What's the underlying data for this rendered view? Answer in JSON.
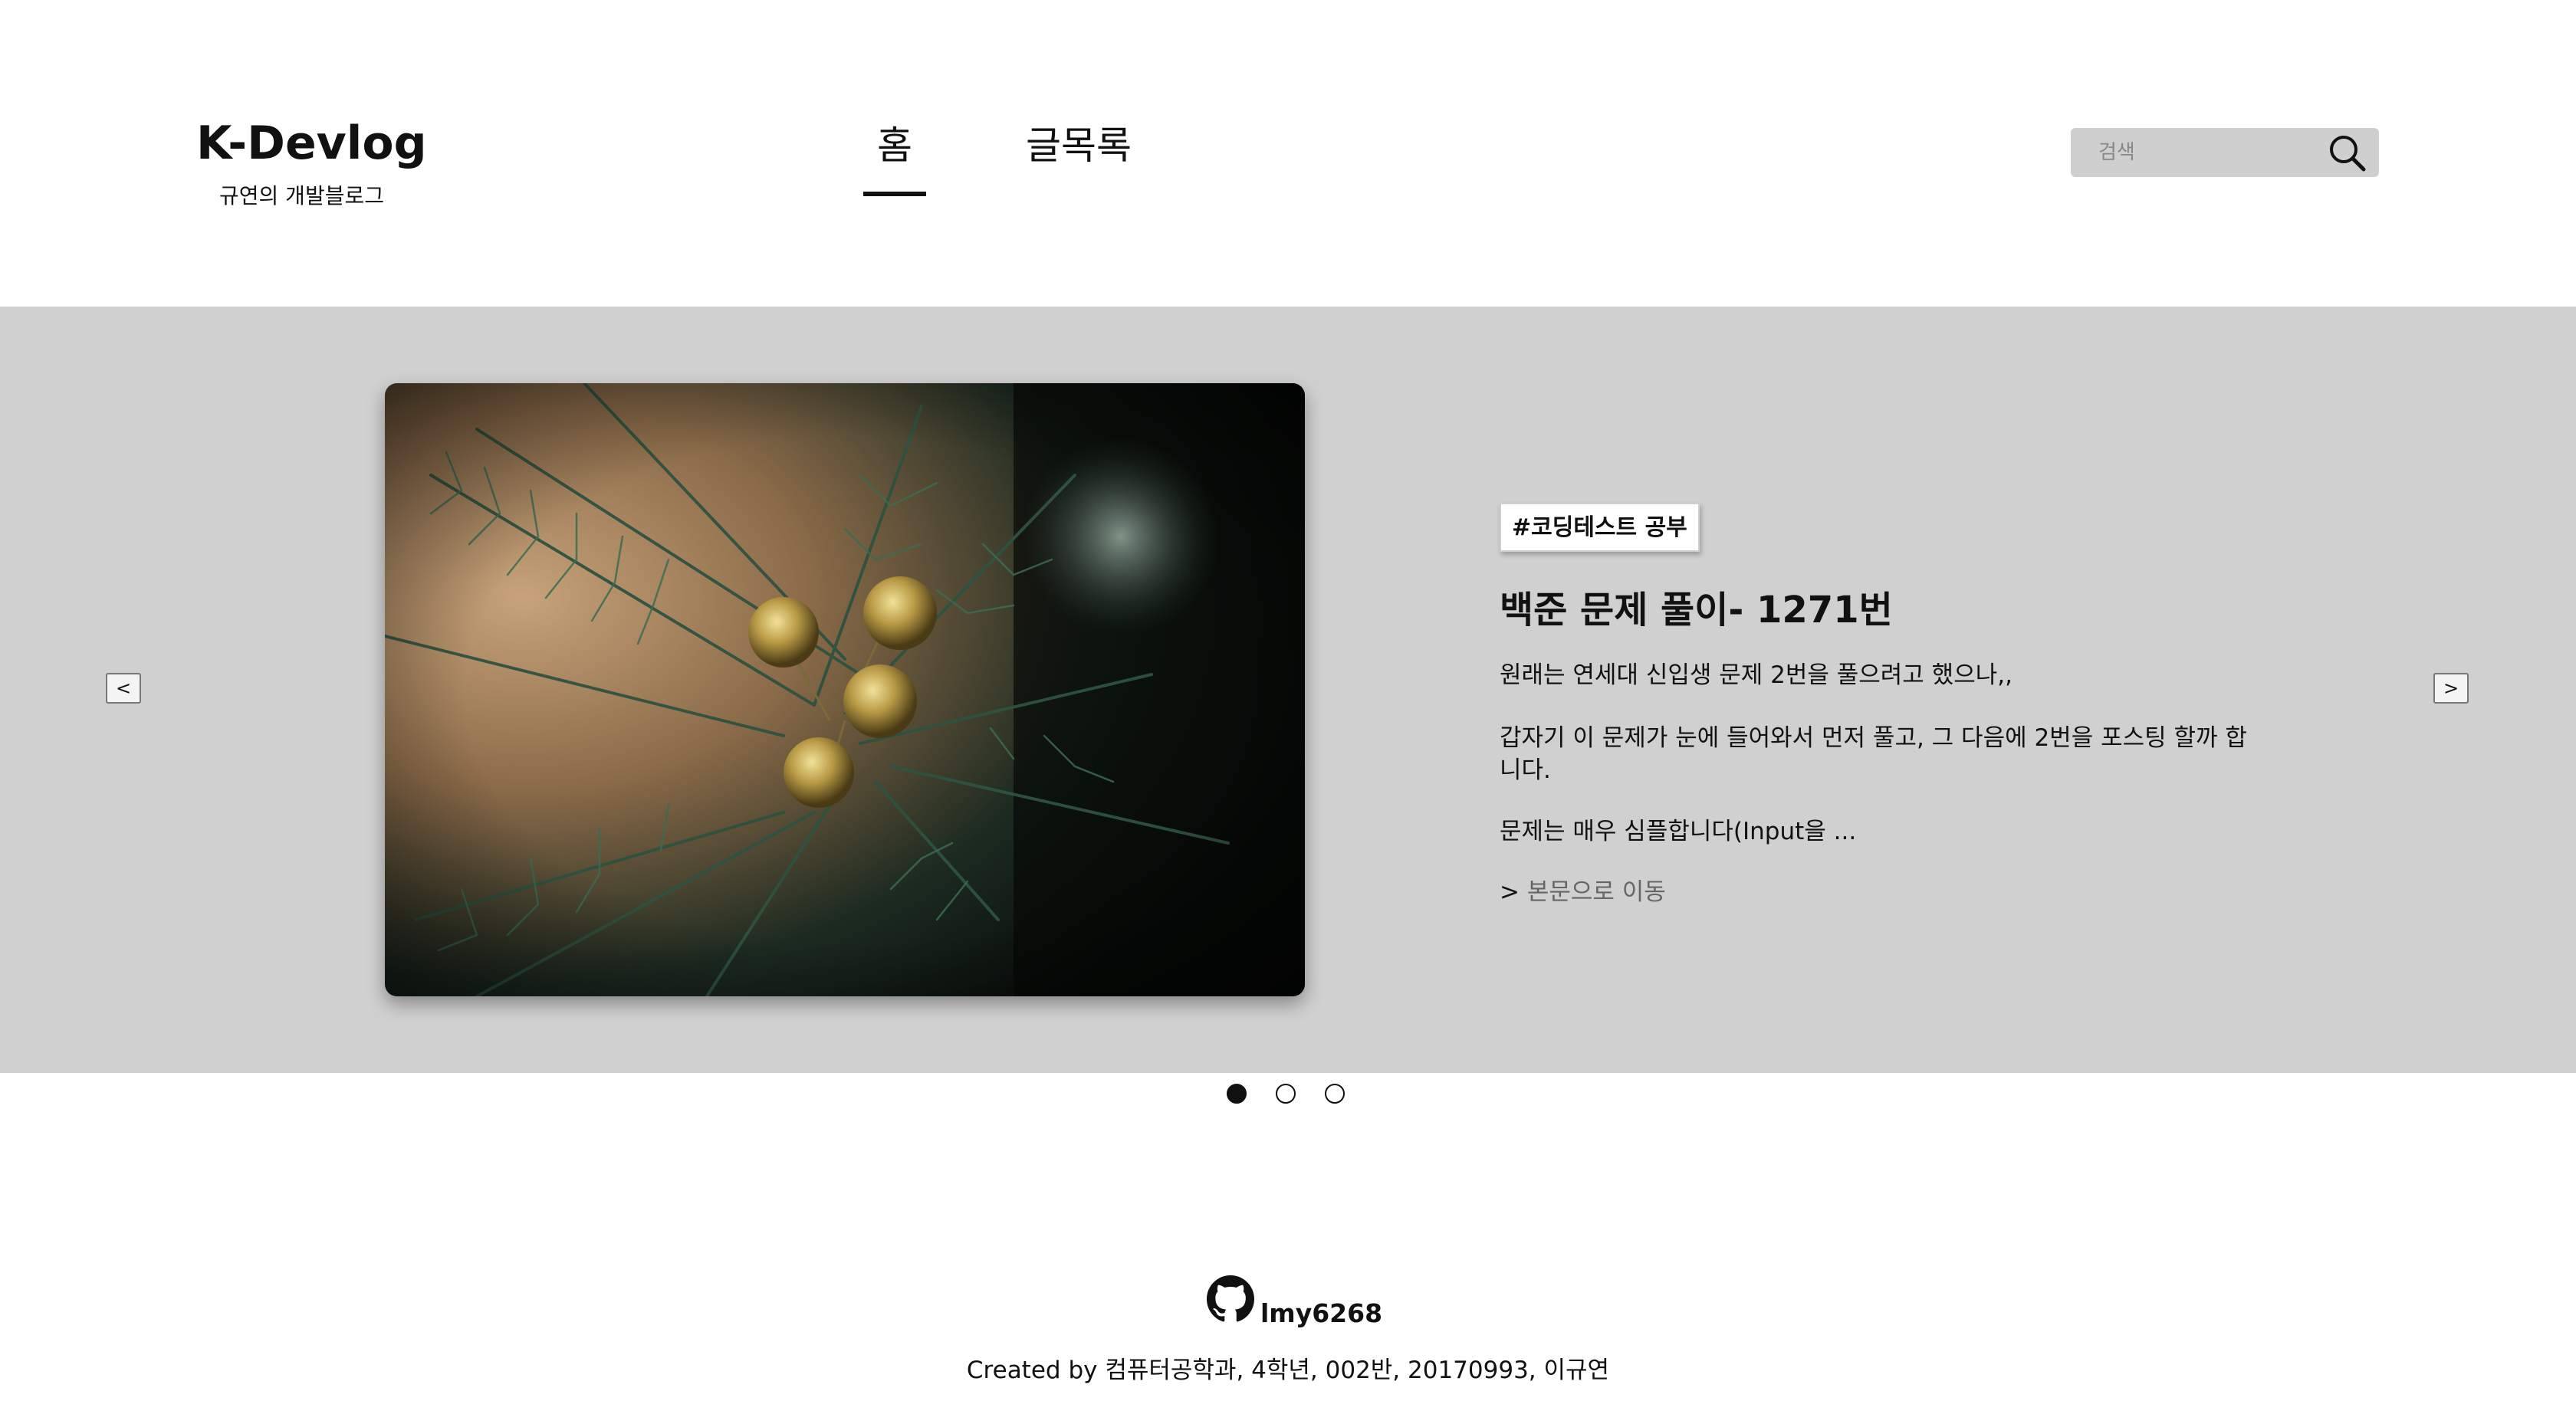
{
  "header": {
    "brand_title": "K-Devlog",
    "brand_subtitle": "규연의 개발블로그",
    "nav": [
      {
        "label": "홈",
        "active": true
      },
      {
        "label": "글목록",
        "active": false
      }
    ],
    "search": {
      "placeholder": "검색",
      "icon": "search-icon"
    }
  },
  "slider": {
    "prev_label": "<",
    "next_label": ">",
    "image_icon": "christmas-tree-branch-photo",
    "tag": "#코딩테스트 공부",
    "title": "백준 문제 풀이- 1271번",
    "excerpt": [
      "원래는 연세대 신입생 문제 2번을 풀으려고 했으나,,",
      "갑자기 이 문제가 눈에 들어와서 먼저 풀고, 그 다음에 2번을 포스팅 할까 합니다.",
      "문제는 매우 심플합니다(Input을 ..."
    ],
    "readmore_prefix": ">",
    "readmore_label": "본문으로 이동",
    "dots": [
      true,
      false,
      false
    ],
    "band_color": "#d0d0d0"
  },
  "footer": {
    "github_icon": "github-icon",
    "username": "lmy6268",
    "credit": "Created by 컴퓨터공학과, 4학년, 002반, 20170993, 이규연"
  }
}
